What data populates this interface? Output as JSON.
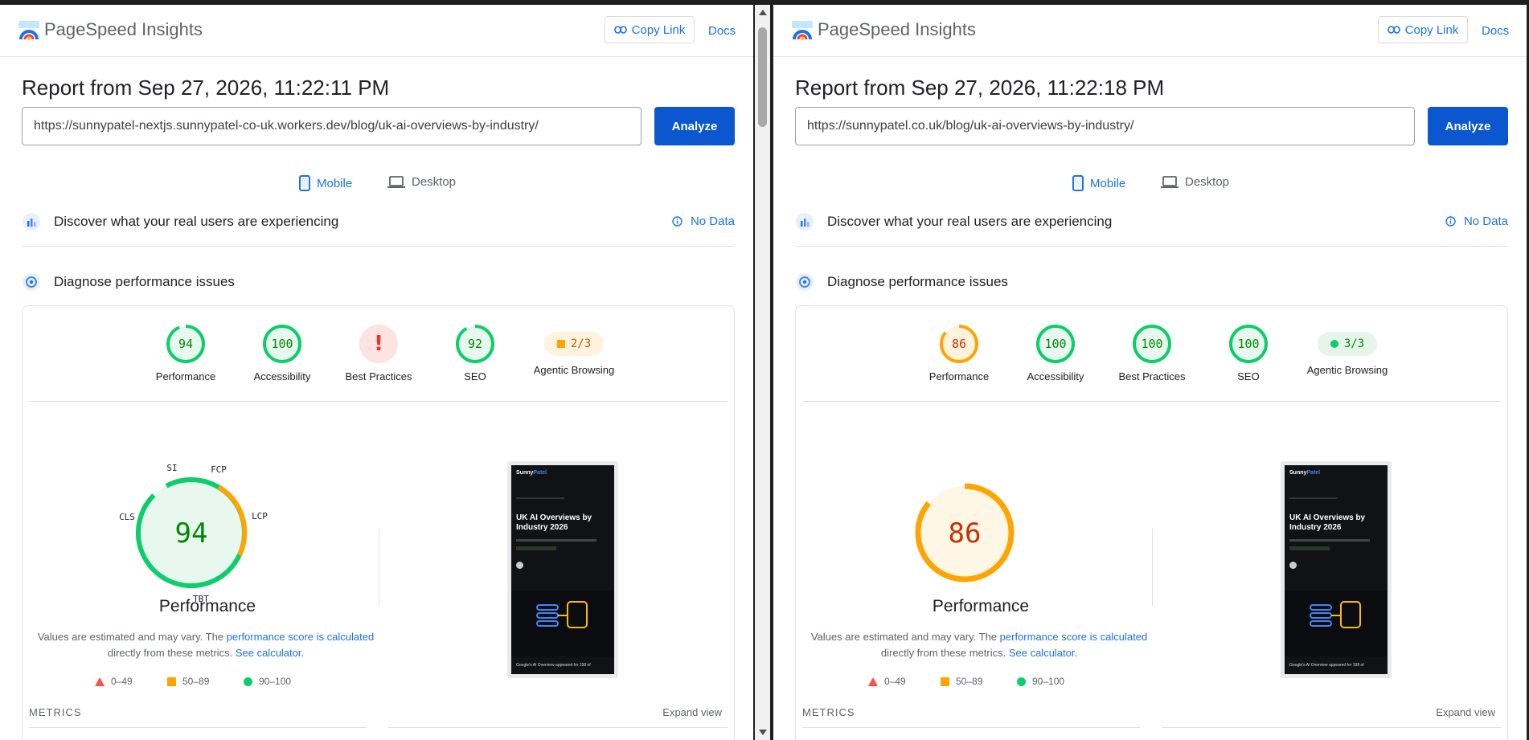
{
  "app": {
    "brand": "PageSpeed Insights",
    "copy_link": "Copy Link",
    "docs": "Docs",
    "analyze": "Analyze"
  },
  "tabs": {
    "mobile": "Mobile",
    "desktop": "Desktop"
  },
  "sections": {
    "real_users": "Discover what your real users are experiencing",
    "no_data": "No Data",
    "diagnose": "Diagnose performance issues"
  },
  "perf_note": {
    "prefix": "Values are estimated and may vary. The ",
    "link1": "performance score is calculated",
    "middle": " directly from these metrics. ",
    "link2": "See calculator."
  },
  "legend": {
    "fail": "0–49",
    "average": "50–89",
    "pass": "90–100"
  },
  "metrics": {
    "title": "METRICS",
    "expand": "Expand view"
  },
  "colors": {
    "pass": "#0cce6b",
    "average": "#ffa400",
    "fail": "#ff4e42",
    "link": "#1a73e8"
  },
  "screenshot": {
    "brand_a": "Sunny",
    "brand_b": "Patel",
    "headline_1": "UK AI Overviews by",
    "headline_2": "Industry 2026",
    "caption": "Google's AI Overview appeared for 198 of"
  },
  "left": {
    "report": "Report from Sep 27, 2026, 11:22:11 PM",
    "url": "https://sunnypatel-nextjs.sunnypatel-co-uk.workers.dev/blog/uk-ai-overviews-by-industry/",
    "scores": {
      "performance": "94",
      "accessibility": "100",
      "best_practices": "!",
      "seo": "92",
      "agentic": "2/3"
    },
    "labels": {
      "performance": "Performance",
      "accessibility": "Accessibility",
      "best_practices": "Best Practices",
      "seo": "SEO",
      "agentic": "Agentic Browsing"
    },
    "perf_big": "94",
    "perf_title": "Performance",
    "metric_labels": {
      "si": "SI",
      "fcp": "FCP",
      "lcp": "LCP",
      "tbt": "TBT",
      "cls": "CLS"
    }
  },
  "right": {
    "report": "Report from Sep 27, 2026, 11:22:18 PM",
    "url": "https://sunnypatel.co.uk/blog/uk-ai-overviews-by-industry/",
    "scores": {
      "performance": "86",
      "accessibility": "100",
      "best_practices": "100",
      "seo": "100",
      "agentic": "3/3"
    },
    "labels": {
      "performance": "Performance",
      "accessibility": "Accessibility",
      "best_practices": "Best Practices",
      "seo": "SEO",
      "agentic": "Agentic Browsing"
    },
    "perf_big": "86",
    "perf_title": "Performance"
  }
}
